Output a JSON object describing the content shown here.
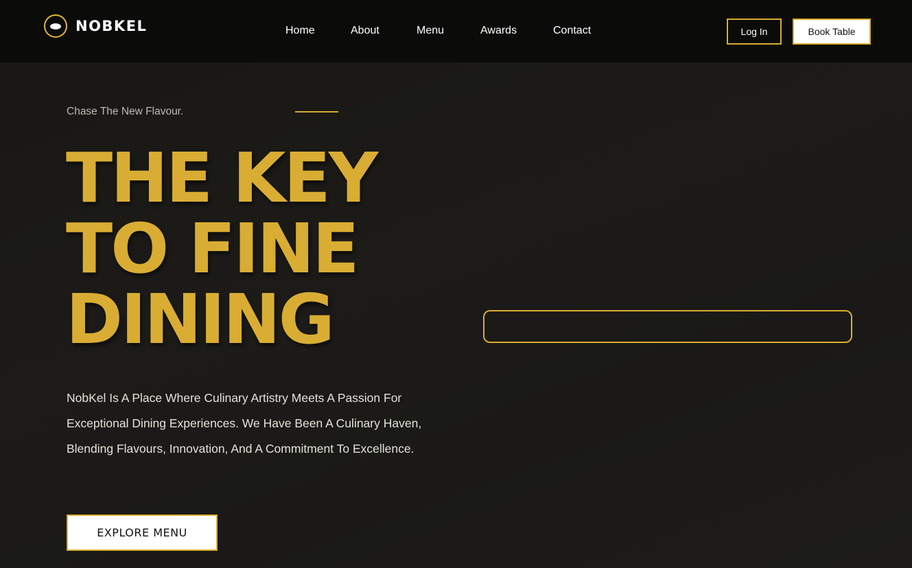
{
  "brand": {
    "name": "NOBKEL",
    "icon": "eye-logo-icon",
    "accent_color": "#d9ad30"
  },
  "nav": {
    "links": [
      {
        "label": "Home"
      },
      {
        "label": "About"
      },
      {
        "label": "Menu"
      },
      {
        "label": "Awards"
      },
      {
        "label": "Contact"
      }
    ],
    "login_label": "Log In",
    "book_label": "Book Table"
  },
  "hero": {
    "tagline": "Chase The New Flavour.",
    "headline_lines": [
      "THE KEY",
      "TO FINE",
      "DINING"
    ],
    "description": "NobKel Is A Place Where Culinary Artistry Meets A Passion For Exceptional Dining Experiences. We Have Been A Culinary Haven, Blending Flavours, Innovation, And A Commitment To Excellence.",
    "cta_label": "EXPLORE MENU"
  }
}
